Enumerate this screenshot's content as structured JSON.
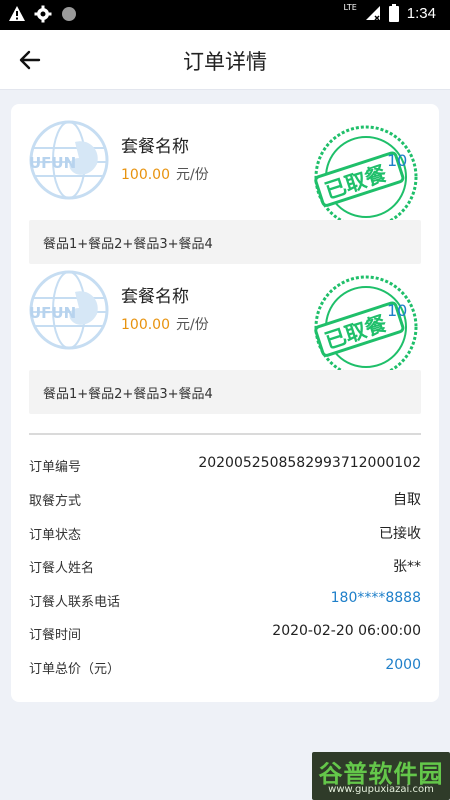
{
  "status_bar": {
    "time": "1:34",
    "network": "LTE"
  },
  "header": {
    "title": "订单详情"
  },
  "packages": [
    {
      "name": "套餐名称",
      "price": "100.00",
      "unit": "元/份",
      "stamp_text": "已取餐",
      "stamp_number": "10",
      "logo_text": "UFUN",
      "items": "餐品1+餐品2+餐品3+餐品4"
    },
    {
      "name": "套餐名称",
      "price": "100.00",
      "unit": "元/份",
      "stamp_text": "已取餐",
      "stamp_number": "10",
      "logo_text": "UFUN",
      "items": "餐品1+餐品2+餐品3+餐品4"
    }
  ],
  "order_info": [
    {
      "label": "订单编号",
      "value": "2020052508582993712000102",
      "style": "normal"
    },
    {
      "label": "取餐方式",
      "value": "自取",
      "style": "normal"
    },
    {
      "label": "订单状态",
      "value": "已接收",
      "style": "normal"
    },
    {
      "label": "订餐人姓名",
      "value": "张**",
      "style": "normal"
    },
    {
      "label": "订餐人联系电话",
      "value": "180****8888",
      "style": "blue"
    },
    {
      "label": "订餐时间",
      "value": "2020-02-20  06:00:00",
      "style": "normal"
    },
    {
      "label": "订单总价（元）",
      "value": "2000",
      "style": "blue"
    }
  ],
  "watermark": {
    "title": "谷普软件园",
    "url": "www.gupuxiazai.com"
  },
  "colors": {
    "price": "#e8930f",
    "link": "#1e7fc9",
    "stamp": "#1fbf6a"
  }
}
